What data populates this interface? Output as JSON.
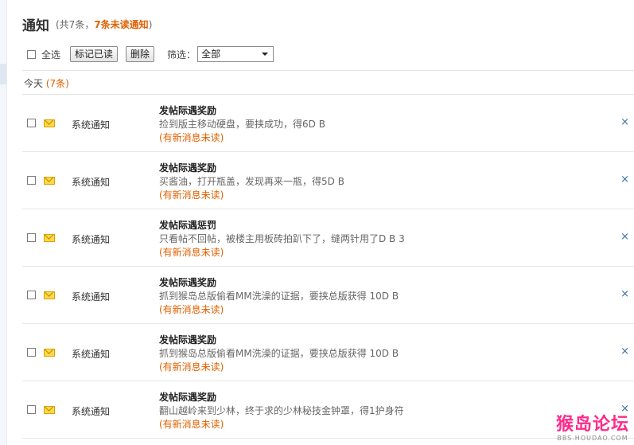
{
  "header": {
    "title": "通知",
    "summary_prefix": "(共7条，",
    "summary_unread": "7条未读通知",
    "summary_suffix": ")"
  },
  "toolbar": {
    "select_all_label": "全选",
    "mark_read_label": "标记已读",
    "delete_label": "删除",
    "filter_label": "筛选：",
    "filter_selected": "全部"
  },
  "section": {
    "today_label": "今天",
    "today_count": "(7条)"
  },
  "notifications": [
    {
      "type": "系统通知",
      "heading": "发帖际遇奖励",
      "desc": "捡到版主移动硬盘，要挟成功，得6D B",
      "status": "(有新消息未读)"
    },
    {
      "type": "系统通知",
      "heading": "发帖际遇奖励",
      "desc": "买酱油，打开瓶盖，发现再来一瓶，得5D B",
      "status": "(有新消息未读)"
    },
    {
      "type": "系统通知",
      "heading": "发帖际遇惩罚",
      "desc": "只看帖不回帖，被楼主用板砖拍趴下了，缝两针用了D B 3",
      "status": "(有新消息未读)"
    },
    {
      "type": "系统通知",
      "heading": "发帖际遇奖励",
      "desc": "抓到猴岛总版偷看MM洗澡的证据，要挟总版获得 10D B",
      "status": "(有新消息未读)"
    },
    {
      "type": "系统通知",
      "heading": "发帖际遇奖励",
      "desc": "抓到猴岛总版偷看MM洗澡的证据，要挟总版获得 10D B",
      "status": "(有新消息未读)"
    },
    {
      "type": "系统通知",
      "heading": "发帖际遇奖励",
      "desc": "翻山越岭来到少林，终于求的少林秘技金钟罩，得1护身符",
      "status": "(有新消息未读)"
    }
  ],
  "watermark": {
    "main": "猴岛论坛",
    "sub": "BBS.HOUDAO.COM"
  },
  "colors": {
    "accent_orange": "#e06000",
    "close_blue": "#3a6ea5"
  }
}
